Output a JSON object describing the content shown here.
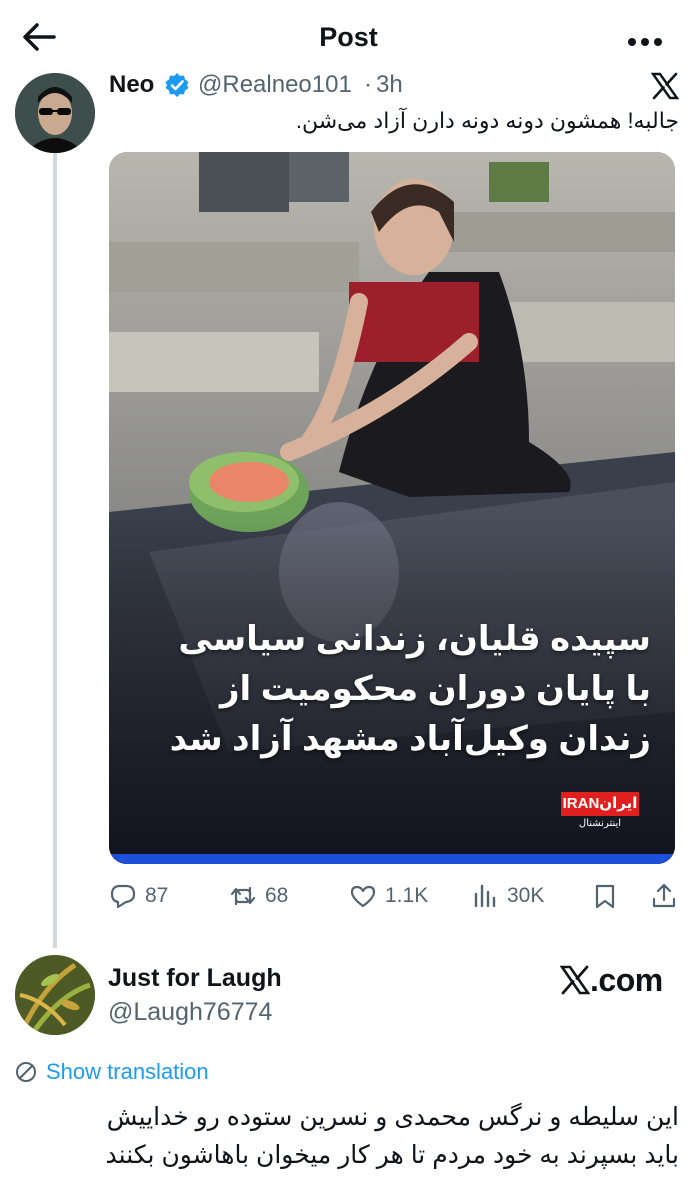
{
  "header": {
    "title": "Post",
    "back_icon": "arrow-left-icon",
    "more_icon": "more-horizontal-icon"
  },
  "tweet1": {
    "author_name": "Neo",
    "handle": "@Realneo101",
    "separator": "·",
    "time": "3h",
    "text": "جالبه! همشون دونه دونه دارن آزاد می‌شن.",
    "media": {
      "caption_lines": [
        "سپیده قلیان، زندانی سیاسی",
        "با پایان دوران محکومیت از",
        "زندان وکیل‌آباد مشهد آزاد شد"
      ],
      "logo_text": "IRANایران",
      "logo_subtext": "اینترنشنال"
    },
    "stats": {
      "replies": "87",
      "retweets": "68",
      "likes": "1.1K",
      "views": "30K"
    }
  },
  "tweet2": {
    "author_name": "Just for Laugh",
    "handle": "@Laugh76774",
    "watermark": ".com",
    "show_translation": "Show translation",
    "text_lines": [
      "این سلیطه و نرگس محمدی و نسرین ستوده رو خداییش",
      "باید بسپرند به خود مردم تا هر کار میخوان باهاشون بکنند"
    ]
  },
  "colors": {
    "accent": "#1d9bf0",
    "secondary_text": "#536471",
    "thread_line": "#cfd9de",
    "brand_red": "#e0201f"
  }
}
